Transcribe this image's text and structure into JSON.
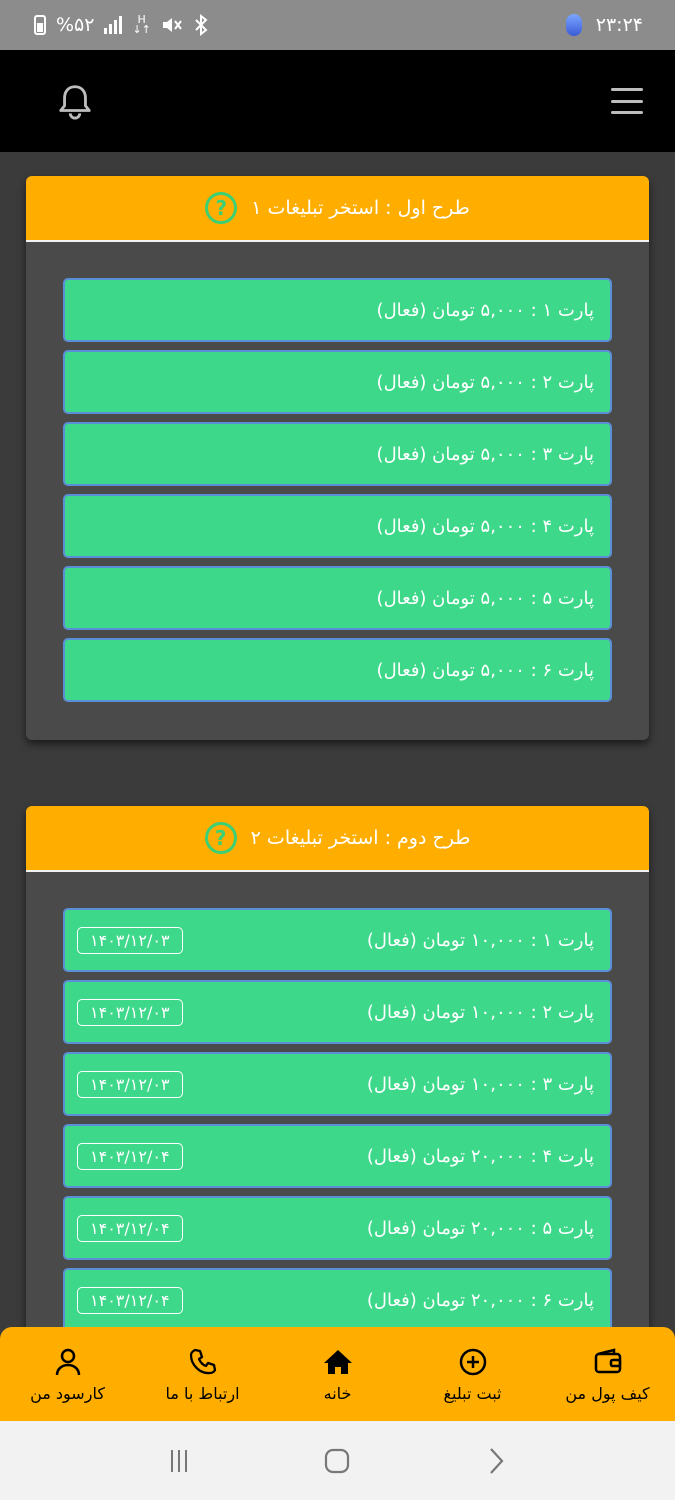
{
  "status_bar": {
    "time": "۲۳:۲۴",
    "battery": "%۵۲"
  },
  "plans": [
    {
      "title": "طرح اول : استخر تبلیغات ۱",
      "parts": [
        {
          "label": "پارت ۱ : ۵,۰۰۰ تومان (فعال)",
          "date": ""
        },
        {
          "label": "پارت ۲ : ۵,۰۰۰ تومان (فعال)",
          "date": ""
        },
        {
          "label": "پارت ۳ : ۵,۰۰۰ تومان (فعال)",
          "date": ""
        },
        {
          "label": "پارت ۴ : ۵,۰۰۰ تومان (فعال)",
          "date": ""
        },
        {
          "label": "پارت ۵ : ۵,۰۰۰ تومان (فعال)",
          "date": ""
        },
        {
          "label": "پارت ۶ : ۵,۰۰۰ تومان (فعال)",
          "date": ""
        }
      ]
    },
    {
      "title": "طرح دوم : استخر تبلیغات ۲",
      "parts": [
        {
          "label": "پارت ۱ : ۱۰,۰۰۰ تومان (فعال)",
          "date": "۱۴۰۳/۱۲/۰۳"
        },
        {
          "label": "پارت ۲ : ۱۰,۰۰۰ تومان (فعال)",
          "date": "۱۴۰۳/۱۲/۰۳"
        },
        {
          "label": "پارت ۳ : ۱۰,۰۰۰ تومان (فعال)",
          "date": "۱۴۰۳/۱۲/۰۳"
        },
        {
          "label": "پارت ۴ : ۲۰,۰۰۰ تومان (فعال)",
          "date": "۱۴۰۳/۱۲/۰۴"
        },
        {
          "label": "پارت ۵ : ۲۰,۰۰۰ تومان (فعال)",
          "date": "۱۴۰۳/۱۲/۰۴"
        },
        {
          "label": "پارت ۶ : ۲۰,۰۰۰ تومان (فعال)",
          "date": "۱۴۰۳/۱۲/۰۴"
        }
      ]
    }
  ],
  "help_glyph": "?",
  "bottom_nav": [
    {
      "label": "کیف پول من",
      "icon": "wallet-icon"
    },
    {
      "label": "ثبت تبلیغ",
      "icon": "plus-circle-icon"
    },
    {
      "label": "خانه",
      "icon": "home-icon"
    },
    {
      "label": "ارتباط با ما",
      "icon": "phone-icon"
    },
    {
      "label": "کارسود من",
      "icon": "user-icon"
    }
  ],
  "colors": {
    "accent": "#ffae00",
    "button_green": "#3dd88a",
    "button_border": "#5b8fd6",
    "card_bg": "#4a4a4a",
    "page_bg": "#3b3b3b",
    "header_bg": "#000000"
  }
}
